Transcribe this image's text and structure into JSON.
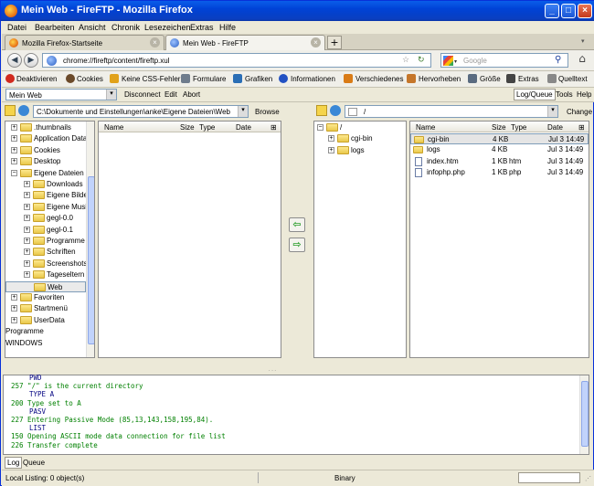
{
  "window": {
    "title": "Mein Web - FireFTP - Mozilla Firefox",
    "min": "_",
    "max": "□",
    "close": "×"
  },
  "menu": [
    "Datei",
    "Bearbeiten",
    "Ansicht",
    "Chronik",
    "Lesezeichen",
    "Extras",
    "Hilfe"
  ],
  "tabs": [
    {
      "label": "Mozilla Firefox-Startseite",
      "close": "×"
    },
    {
      "label": "Mein Web - FireFTP",
      "close": "×"
    }
  ],
  "new_tab": "+",
  "nav": {
    "back": "◀",
    "forward": "▶",
    "url": "chrome://fireftp/content/fireftp.xul",
    "search_placeholder": "Google",
    "star": "☆",
    "reload": "↻",
    "search_go": "⚲",
    "home": "⌂"
  },
  "devbar": [
    {
      "label": "Deaktivieren",
      "color": "#d12a1e"
    },
    {
      "label": "Cookies",
      "color": "#6b4a2a"
    },
    {
      "label": "Keine CSS-Fehler",
      "color": "#e1a21b"
    },
    {
      "label": "Formulare",
      "color": "#6f7c8c"
    },
    {
      "label": "Grafiken",
      "color": "#2a6eb5"
    },
    {
      "label": "Informationen",
      "color": "#2251c3"
    },
    {
      "label": "Verschiedenes",
      "color": "#d97b16"
    },
    {
      "label": "Hervorheben",
      "color": "#c5762a"
    },
    {
      "label": "Größe",
      "color": "#5a6b80"
    },
    {
      "label": "Extras",
      "color": "#444"
    },
    {
      "label": "Quelltext",
      "color": "#888"
    }
  ],
  "ftpbar": {
    "account": "Mein Web",
    "disconnect": "Disconnect",
    "edit": "Edit",
    "abort": "Abort",
    "log_queue": "Log/Queue",
    "tools": "Tools",
    "help": "Help"
  },
  "local": {
    "path": "C:\\Dokumente und Einstellungen\\anke\\Eigene Dateien\\Web",
    "browse": "Browse",
    "tree": [
      {
        "label": ".thumbnails",
        "level": 0,
        "toggle": "+"
      },
      {
        "label": "Application Data",
        "level": 0,
        "toggle": "+"
      },
      {
        "label": "Cookies",
        "level": 0,
        "toggle": "+"
      },
      {
        "label": "Desktop",
        "level": 0,
        "toggle": "+"
      },
      {
        "label": "Eigene Dateien",
        "level": 0,
        "toggle": "−"
      },
      {
        "label": "Downloads",
        "level": 1,
        "toggle": "+"
      },
      {
        "label": "Eigene Bilder",
        "level": 1,
        "toggle": "+"
      },
      {
        "label": "Eigene Musik",
        "level": 1,
        "toggle": "+"
      },
      {
        "label": "gegl-0.0",
        "level": 1,
        "toggle": "+"
      },
      {
        "label": "gegl-0.1",
        "level": 1,
        "toggle": "+"
      },
      {
        "label": "Programme",
        "level": 1,
        "toggle": "+"
      },
      {
        "label": "Schriften",
        "level": 1,
        "toggle": "+"
      },
      {
        "label": "Screenshots",
        "level": 1,
        "toggle": "+"
      },
      {
        "label": "Tageseltern",
        "level": 1,
        "toggle": "+"
      },
      {
        "label": "Web",
        "level": 1,
        "toggle": ""
      },
      {
        "label": "Favoriten",
        "level": 0,
        "toggle": "+"
      },
      {
        "label": "Startmenü",
        "level": 0,
        "toggle": "+"
      },
      {
        "label": "UserData",
        "level": 0,
        "toggle": "+"
      },
      {
        "label": "Programme",
        "level": -1,
        "toggle": ""
      },
      {
        "label": "WINDOWS",
        "level": -1,
        "toggle": ""
      }
    ],
    "columns": {
      "name": "Name",
      "size": "Size",
      "type": "Type",
      "date": "Date"
    }
  },
  "remote": {
    "path": "/",
    "change": "Change",
    "tree": [
      {
        "label": "/",
        "level": 0,
        "toggle": "−"
      },
      {
        "label": "cgi-bin",
        "level": 1,
        "toggle": "+"
      },
      {
        "label": "logs",
        "level": 1,
        "toggle": "+"
      }
    ],
    "columns": {
      "name": "Name",
      "size": "Size",
      "type": "Type",
      "date": "Date"
    },
    "files": [
      {
        "name": "cgi-bin",
        "size": "4 KB",
        "type": "",
        "date": "Jul 3 14:49",
        "kind": "folder"
      },
      {
        "name": "logs",
        "size": "4 KB",
        "type": "",
        "date": "Jul 3 14:49",
        "kind": "folder"
      },
      {
        "name": "index.htm",
        "size": "1 KB",
        "type": "htm",
        "date": "Jul 3 14:49",
        "kind": "file"
      },
      {
        "name": "infophp.php",
        "size": "1 KB",
        "type": "php",
        "date": "Jul 3 14:49",
        "kind": "file"
      }
    ]
  },
  "transfer": {
    "upload": "⇨",
    "download": "⇦"
  },
  "log": [
    {
      "text": "PWD",
      "kind": "cmd"
    },
    {
      "text": "257 \"/\" is the current directory",
      "kind": "resp"
    },
    {
      "text": "TYPE A",
      "kind": "cmd"
    },
    {
      "text": "200 Type set to A",
      "kind": "resp"
    },
    {
      "text": "PASV",
      "kind": "cmd"
    },
    {
      "text": "227 Entering Passive Mode (85,13,143,158,195,84).",
      "kind": "resp"
    },
    {
      "text": "LIST",
      "kind": "cmd"
    },
    {
      "text": "150 Opening ASCII mode data connection for file list",
      "kind": "resp"
    },
    {
      "text": "226 Transfer complete",
      "kind": "resp"
    }
  ],
  "log_tabs": [
    "Log",
    "Queue"
  ],
  "status": {
    "listing": "Local Listing: 0 object(s)",
    "mode": "Binary"
  }
}
